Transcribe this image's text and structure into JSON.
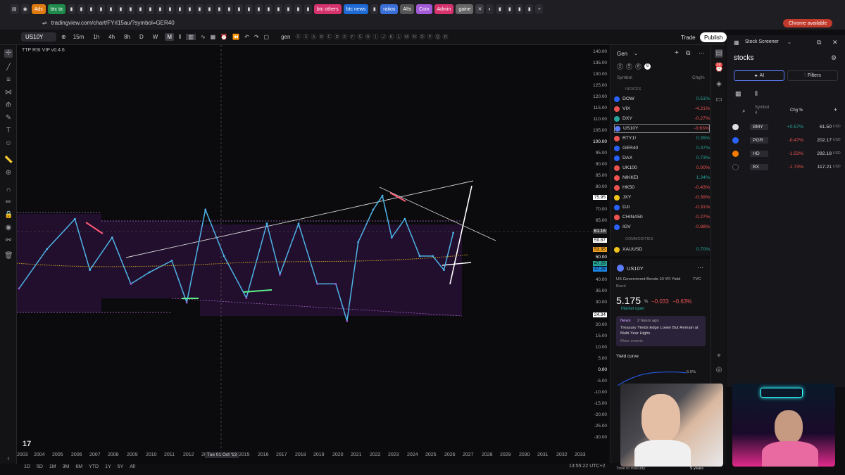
{
  "browser": {
    "tabs": [
      "Ads",
      "btc ta",
      "btc others",
      "btc news",
      "ratios",
      "Alts",
      "Coin",
      "Admin",
      "gaine"
    ],
    "url": "tradingview.com/chart/FYrl15au/?symbol=GER40",
    "chrome_available": "Chrome available",
    "notification_count": "12"
  },
  "toolbar": {
    "symbol": "US10Y",
    "intervals": [
      "15m",
      "1h",
      "4h",
      "8h",
      "D",
      "W",
      "M"
    ],
    "active_interval": "M",
    "layout_name": "gen",
    "trade": "Trade",
    "publish": "Publish"
  },
  "chart": {
    "indicator": "TTP RSI VIP v0.4.6",
    "price_labels": [
      "140.00",
      "135.00",
      "130.00",
      "125.00",
      "120.00",
      "115.00",
      "110.00",
      "105.00",
      "100.00",
      "95.00",
      "90.00",
      "85.00",
      "80.00",
      "75.95",
      "70.00",
      "65.00",
      "61.16",
      "59.87",
      "53.35",
      "50.00",
      "47.28",
      "47.28",
      "40.00",
      "35.00",
      "30.00",
      "24.34",
      "20.00",
      "15.00",
      "10.00",
      "5.00",
      "0.00",
      "-5.00",
      "-10.00",
      "-15.00",
      "-20.00",
      "-25.00",
      "-30.00"
    ],
    "years": [
      "2003",
      "2004",
      "2005",
      "2006",
      "2007",
      "2008",
      "2009",
      "2010",
      "2011",
      "2012",
      "2013",
      "2015",
      "2016",
      "2017",
      "2018",
      "2019",
      "2020",
      "2021",
      "2022",
      "2023",
      "2024",
      "2025",
      "2026",
      "2027",
      "2028",
      "2029",
      "2030",
      "2031",
      "2032",
      "2033"
    ],
    "crosshair_date": "Tue 01 Oct '13",
    "ranges": [
      "1D",
      "5D",
      "1M",
      "3M",
      "6M",
      "YTD",
      "1Y",
      "5Y",
      "All"
    ],
    "clock": "13:55:22 UTC+2",
    "accent": "#7b3fa0"
  },
  "chart_data": {
    "type": "line",
    "title": "",
    "x": [
      2003.0,
      2004.5,
      2006.0,
      2006.8,
      2008.0,
      2009.0,
      2010.0,
      2011.2,
      2012.0,
      2013.0,
      2014.0,
      2015.2,
      2016.3,
      2017.0,
      2018.0,
      2019.0,
      2020.0,
      2020.6,
      2021.2,
      2022.0,
      2022.5,
      2023.0,
      2023.7,
      2024.5,
      2025.2,
      2025.8,
      2026.3
    ],
    "series": [
      {
        "values": [
          38,
          55,
          68,
          46,
          60,
          40,
          45,
          50,
          32,
          72,
          52,
          34,
          66,
          44,
          66,
          40,
          40,
          24,
          58,
          72,
          78,
          60,
          68,
          52,
          52,
          46,
          62
        ]
      }
    ],
    "ylim": [
      -30,
      140
    ],
    "xlim": [
      2003,
      2033
    ]
  },
  "watchlist": {
    "name": "Gen",
    "section_indices": "INDICES",
    "section_commodities": "COMMODITIES",
    "col_symbol": "Symbol",
    "col_chg": "Chg%",
    "tabs": [
      "2",
      "5",
      "6",
      "6"
    ],
    "items": [
      {
        "sym": "DOW",
        "chg": "0.51%",
        "neg": false,
        "color": "#2962ff"
      },
      {
        "sym": "VIX",
        "chg": "-4.21%",
        "neg": true,
        "color": "#ef5350"
      },
      {
        "sym": "DXY",
        "chg": "-0.27%",
        "neg": true,
        "color": "#26a69a"
      },
      {
        "sym": "US10Y",
        "chg": "-0.63%",
        "neg": true,
        "color": "#5b7cfa"
      },
      {
        "sym": "RTY1!",
        "chg": "0.35%",
        "neg": false,
        "color": "#ef5350"
      },
      {
        "sym": "GER40",
        "chg": "0.37%",
        "neg": false,
        "color": "#2962ff"
      },
      {
        "sym": "DAX",
        "chg": "0.73%",
        "neg": false,
        "color": "#2962ff"
      },
      {
        "sym": "UK100",
        "chg": "0.00%",
        "neg": true,
        "color": "#ef5350"
      },
      {
        "sym": "NIKKEI",
        "chg": "1.34%",
        "neg": false,
        "color": "#ef5350"
      },
      {
        "sym": "HK50",
        "chg": "-0.43%",
        "neg": true,
        "color": "#ef5350"
      },
      {
        "sym": "JXY",
        "chg": "-0.39%",
        "neg": true,
        "color": "#f0c419"
      },
      {
        "sym": "DJI",
        "chg": "-0.31%",
        "neg": true,
        "color": "#2962ff"
      },
      {
        "sym": "CHINA50",
        "chg": "-0.27%",
        "neg": true,
        "color": "#ef5350"
      },
      {
        "sym": "IGV",
        "chg": "-0.88%",
        "neg": true,
        "color": "#2962ff"
      },
      {
        "sym": "XAUUSD",
        "chg": "0.70%",
        "neg": false,
        "color": "#f0c419"
      }
    ]
  },
  "detail": {
    "symbol": "US10Y",
    "description": "US Government Bonds 10 YR Yield",
    "source": "TVC",
    "type": "Bond",
    "price": "5.175",
    "unit": "%",
    "change": "−0.033",
    "change_pct": "−0.63%",
    "market": "Market open",
    "news_label": "News",
    "news_time": "2 hours ago",
    "news_title": "Treasury Yields Edge Lower But Remain at Multi-Year Highs",
    "more_events": "More events",
    "yield_curve": "Yield curve",
    "yc_top": "5.5%",
    "time_to_maturity": "Time to maturity",
    "maturity_value": "9 years"
  },
  "screener": {
    "title": "Stock Screener",
    "list": "stocks",
    "ai": "AI",
    "filters": "Filters",
    "col_symbol": "Symbol",
    "col_count": "4",
    "col_chg": "Chg %",
    "rows": [
      {
        "sym": "BMY",
        "chg": "+0.57%",
        "neg": false,
        "price": "61.50",
        "cur": "USD",
        "color": "#e0e0e0"
      },
      {
        "sym": "PGR",
        "chg": "-0.47%",
        "neg": true,
        "price": "202.17",
        "cur": "USD",
        "color": "#2962ff"
      },
      {
        "sym": "HD",
        "chg": "-1.53%",
        "neg": true,
        "price": "292.18",
        "cur": "USD",
        "color": "#f57c00"
      },
      {
        "sym": "BX",
        "chg": "-1.73%",
        "neg": true,
        "price": "117.21",
        "cur": "USD",
        "color": "#000000"
      }
    ]
  }
}
